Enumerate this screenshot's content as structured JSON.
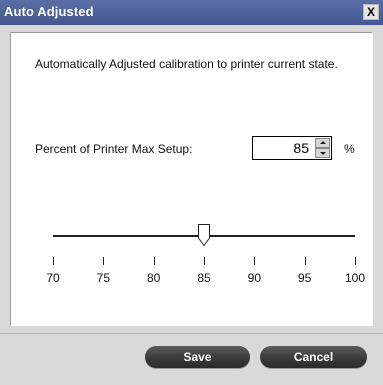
{
  "window": {
    "title": "Auto Adjusted",
    "close_glyph": "X"
  },
  "content": {
    "description": "Automatically Adjusted calibration to printer current state.",
    "setup_label": "Percent of Printer Max Setup:",
    "spinner_value": "85",
    "unit": "%"
  },
  "slider": {
    "min": 70,
    "max": 100,
    "value": 85,
    "ticks": [
      "70",
      "75",
      "80",
      "85",
      "90",
      "95",
      "100"
    ]
  },
  "buttons": {
    "save": "Save",
    "cancel": "Cancel"
  },
  "colors": {
    "titlebar": "#44578f",
    "button": "#3a3a3a"
  }
}
